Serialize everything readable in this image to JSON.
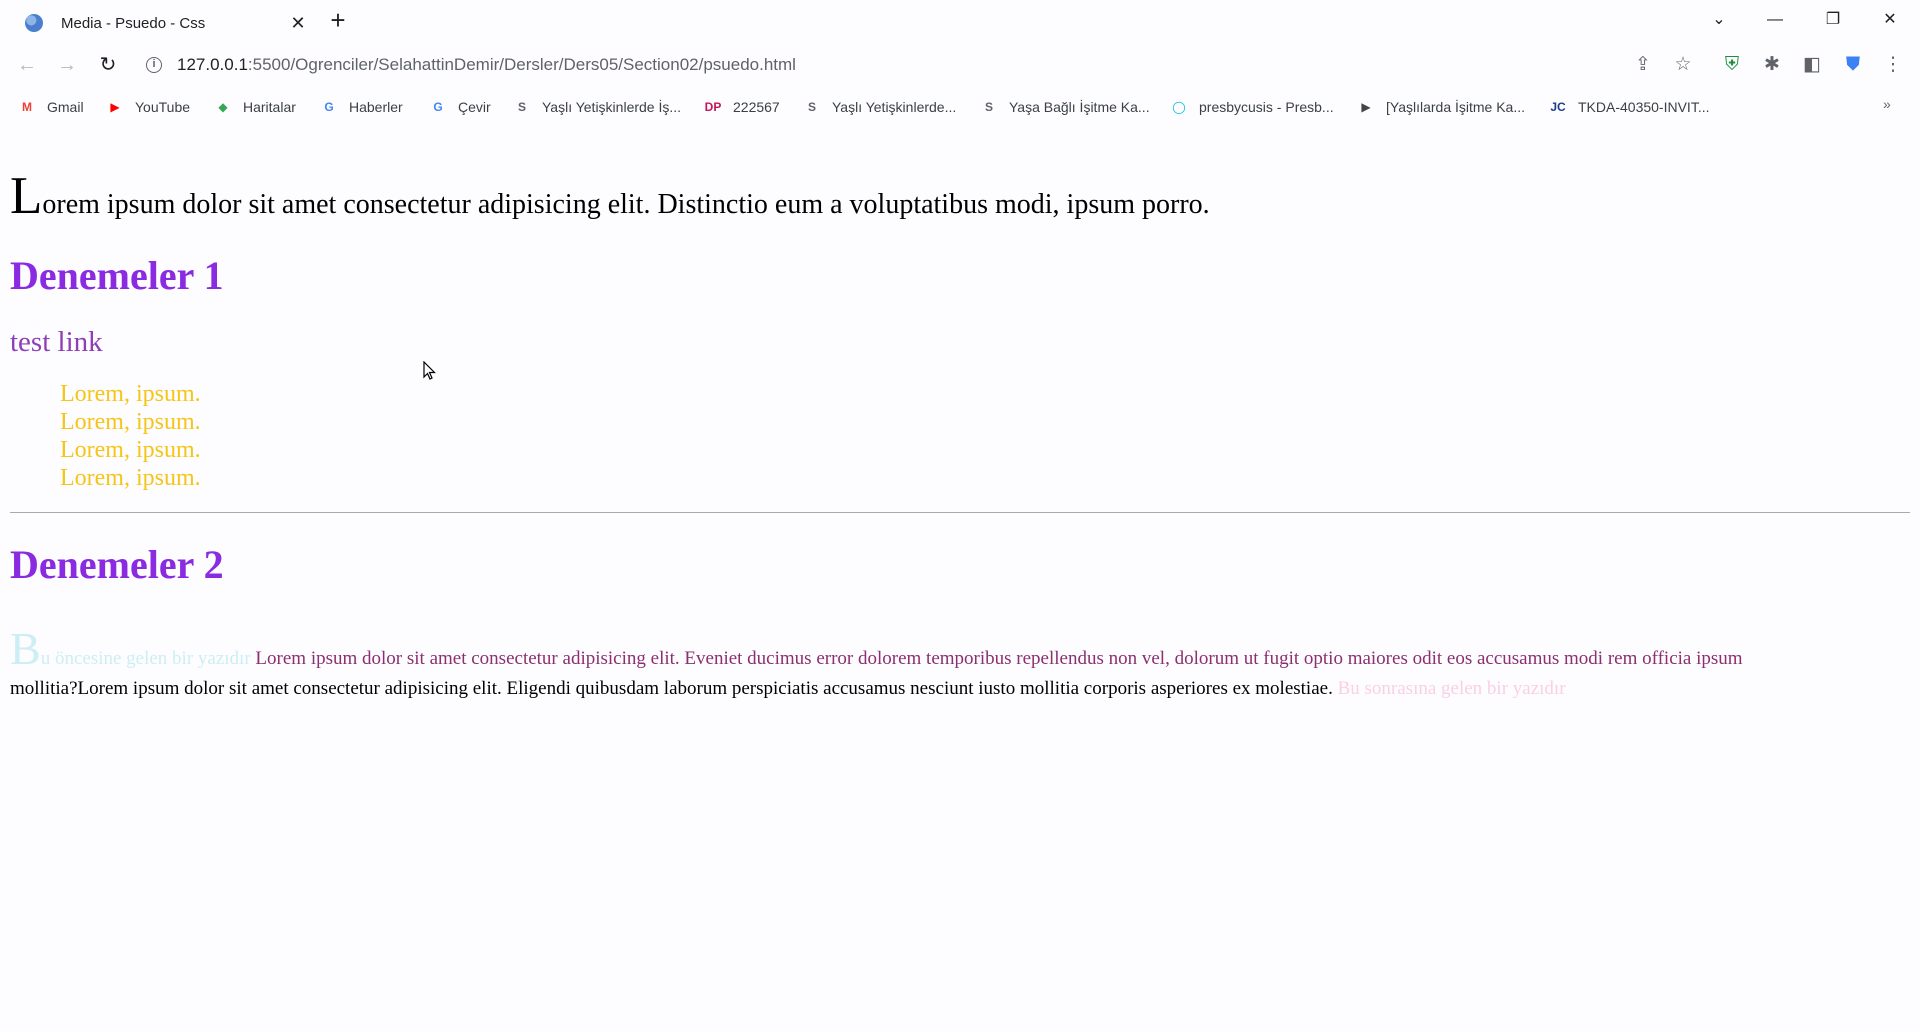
{
  "tab": {
    "title": "Media - Psuedo - Css"
  },
  "address": {
    "host": "127.0.0.1",
    "path": ":5500/Ogrenciler/SelahattinDemir/Dersler/Ders05/Section02/psuedo.html"
  },
  "bookmarks": [
    {
      "label": "Gmail",
      "icon": "gmail-icon",
      "color": "#ea4335",
      "glyph": "M"
    },
    {
      "label": "YouTube",
      "icon": "youtube-icon",
      "color": "#ff0000",
      "glyph": "▶"
    },
    {
      "label": "Haritalar",
      "icon": "maps-icon",
      "color": "#34a853",
      "glyph": "◆"
    },
    {
      "label": "Haberler",
      "icon": "news-icon",
      "color": "#4285f4",
      "glyph": "G"
    },
    {
      "label": "Çevir",
      "icon": "translate-icon",
      "color": "#4285f4",
      "glyph": "G"
    },
    {
      "label": "Yaşlı Yetişkinlerde İş...",
      "icon": "link-icon",
      "color": "#5f6368",
      "glyph": "S"
    },
    {
      "label": "222567",
      "icon": "dp-icon",
      "color": "#c2185b",
      "glyph": "DP"
    },
    {
      "label": "Yaşlı Yetişkinlerde...",
      "icon": "link-icon",
      "color": "#5f6368",
      "glyph": "S"
    },
    {
      "label": "Yaşa Bağlı İşitme Ka...",
      "icon": "link-icon",
      "color": "#5f6368",
      "glyph": "S"
    },
    {
      "label": "presbycusis - Presb...",
      "icon": "search-icon",
      "color": "#00bcd4",
      "glyph": "◯"
    },
    {
      "label": "[Yaşlılarda İşitme Ka...",
      "icon": "doc-icon",
      "color": "#444444",
      "glyph": "▶"
    },
    {
      "label": "TKDA-40350-INVIT...",
      "icon": "jc-icon",
      "color": "#1a3e8c",
      "glyph": "JC"
    }
  ],
  "content": {
    "intro_first": "L",
    "intro_rest": "orem ipsum dolor sit amet consectetur adipisicing elit. Distinctio eum a voluptatibus modi, ipsum porro.",
    "heading1": "Denemeler 1",
    "link": "test link",
    "list_items": [
      "Lorem, ipsum.",
      "Lorem, ipsum.",
      "Lorem, ipsum.",
      "Lorem, ipsum."
    ],
    "heading2": "Denemeler 2",
    "before_cap": "B",
    "before_rest": "u öncesine gelen bir yazıdır",
    "para_line1": " Lorem ipsum dolor sit amet consectetur adipisicing elit. Eveniet ducimus error dolorem temporibus repellendus non vel, dolorum ut fugit optio maiores odit eos accusamus modi rem officia ipsum",
    "para_line2": "mollitia?Lorem ipsum dolor sit amet consectetur adipisicing elit. Eligendi quibusdam laborum perspiciatis accusamus nesciunt iusto mollitia corporis asperiores ex molestiae.",
    "after_text": " Bu sonrasına gelen bir yazıdır"
  },
  "colors": {
    "heading": "#8a2be2",
    "link": "#8e3fb8",
    "list": "#f5c518",
    "before": "#cdeef4",
    "after": "#fad0e2",
    "first_line": "#8b2f70"
  }
}
